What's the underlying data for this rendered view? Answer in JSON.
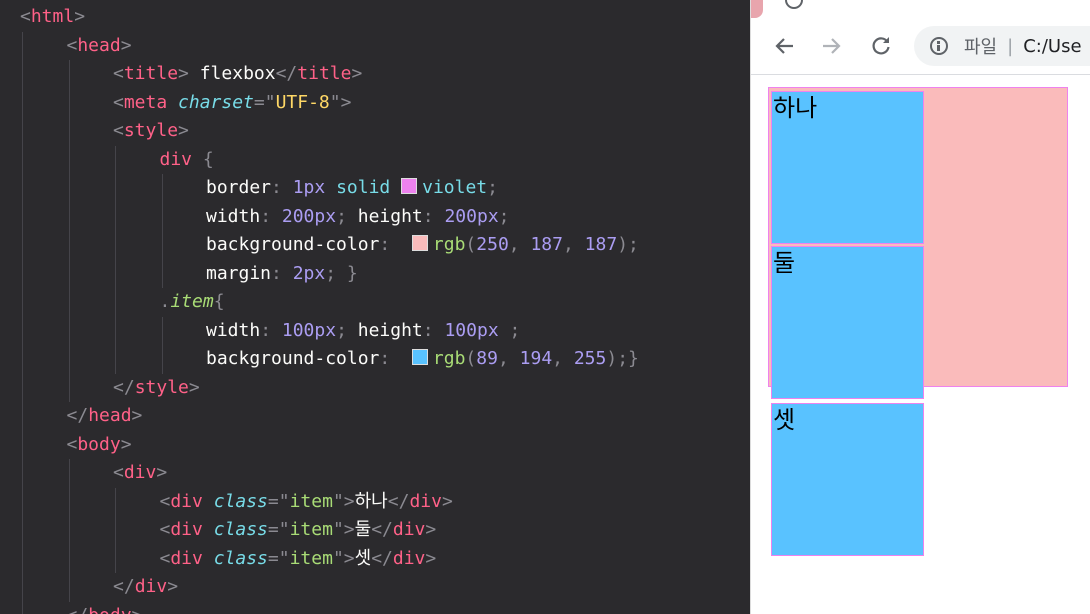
{
  "editor": {
    "lines": [
      {
        "indent": 0,
        "tokens": [
          [
            "punc",
            "<"
          ],
          [
            "tag",
            "html"
          ],
          [
            "punc",
            ">"
          ]
        ]
      },
      {
        "indent": 1,
        "tokens": [
          [
            "punc",
            "<"
          ],
          [
            "tag",
            "head"
          ],
          [
            "punc",
            ">"
          ]
        ]
      },
      {
        "indent": 2,
        "tokens": [
          [
            "punc",
            "<"
          ],
          [
            "tag",
            "title"
          ],
          [
            "punc",
            "> "
          ],
          [
            "text",
            "flexbox"
          ],
          [
            "punc",
            "</"
          ],
          [
            "tag",
            "title"
          ],
          [
            "punc",
            ">"
          ]
        ]
      },
      {
        "indent": 2,
        "tokens": [
          [
            "punc",
            "<"
          ],
          [
            "tag",
            "meta "
          ],
          [
            "attr",
            "charset"
          ],
          [
            "punc",
            "=\""
          ],
          [
            "str",
            "UTF-8"
          ],
          [
            "punc",
            "\">"
          ]
        ]
      },
      {
        "indent": 2,
        "tokens": [
          [
            "punc",
            "<"
          ],
          [
            "tag",
            "style"
          ],
          [
            "punc",
            ">"
          ]
        ]
      },
      {
        "indent": 3,
        "tokens": [
          [
            "tag",
            "div "
          ],
          [
            "punc",
            "{"
          ]
        ]
      },
      {
        "indent": 4,
        "tokens": [
          [
            "prop",
            "border"
          ],
          [
            "punc",
            ": "
          ],
          [
            "num",
            "1px "
          ],
          [
            "kw",
            "solid "
          ],
          [
            "swatch",
            "#ee82ee"
          ],
          [
            "kw",
            "violet"
          ],
          [
            "punc",
            ";"
          ]
        ]
      },
      {
        "indent": 4,
        "tokens": [
          [
            "prop",
            "width"
          ],
          [
            "punc",
            ": "
          ],
          [
            "num",
            "200px"
          ],
          [
            "punc",
            "; "
          ],
          [
            "prop",
            "height"
          ],
          [
            "punc",
            ": "
          ],
          [
            "num",
            "200px"
          ],
          [
            "punc",
            ";"
          ]
        ]
      },
      {
        "indent": 4,
        "tokens": [
          [
            "prop",
            "background-color"
          ],
          [
            "punc",
            ":  "
          ],
          [
            "swatch",
            "#fabbbb"
          ],
          [
            "fn",
            "rgb"
          ],
          [
            "punc",
            "("
          ],
          [
            "num",
            "250"
          ],
          [
            "punc",
            ", "
          ],
          [
            "num",
            "187"
          ],
          [
            "punc",
            ", "
          ],
          [
            "num",
            "187"
          ],
          [
            "punc",
            ");"
          ]
        ]
      },
      {
        "indent": 4,
        "tokens": [
          [
            "prop",
            "margin"
          ],
          [
            "punc",
            ": "
          ],
          [
            "num",
            "2px"
          ],
          [
            "punc",
            "; }"
          ]
        ]
      },
      {
        "indent": 3,
        "tokens": [
          [
            "punc",
            "."
          ],
          [
            "cls",
            "item"
          ],
          [
            "punc",
            "{"
          ]
        ]
      },
      {
        "indent": 4,
        "tokens": [
          [
            "prop",
            "width"
          ],
          [
            "punc",
            ": "
          ],
          [
            "num",
            "100px"
          ],
          [
            "punc",
            "; "
          ],
          [
            "prop",
            "height"
          ],
          [
            "punc",
            ": "
          ],
          [
            "num",
            "100px "
          ],
          [
            "punc",
            ";"
          ]
        ]
      },
      {
        "indent": 4,
        "tokens": [
          [
            "prop",
            "background-color"
          ],
          [
            "punc",
            ":  "
          ],
          [
            "swatch",
            "#59c2ff"
          ],
          [
            "fn",
            "rgb"
          ],
          [
            "punc",
            "("
          ],
          [
            "num",
            "89"
          ],
          [
            "punc",
            ", "
          ],
          [
            "num",
            "194"
          ],
          [
            "punc",
            ", "
          ],
          [
            "num",
            "255"
          ],
          [
            "punc",
            ");}"
          ]
        ]
      },
      {
        "indent": 2,
        "tokens": [
          [
            "punc",
            "</"
          ],
          [
            "tag",
            "style"
          ],
          [
            "punc",
            ">"
          ]
        ]
      },
      {
        "indent": 1,
        "tokens": [
          [
            "punc",
            "</"
          ],
          [
            "tag",
            "head"
          ],
          [
            "punc",
            ">"
          ]
        ]
      },
      {
        "indent": 1,
        "tokens": [
          [
            "punc",
            "<"
          ],
          [
            "tag",
            "body"
          ],
          [
            "punc",
            ">"
          ]
        ]
      },
      {
        "indent": 2,
        "tokens": [
          [
            "punc",
            "<"
          ],
          [
            "tag",
            "div"
          ],
          [
            "punc",
            ">"
          ]
        ]
      },
      {
        "indent": 3,
        "tokens": [
          [
            "punc",
            "<"
          ],
          [
            "tag",
            "div "
          ],
          [
            "attr",
            "class"
          ],
          [
            "punc",
            "=\""
          ],
          [
            "strg",
            "item"
          ],
          [
            "punc",
            "\">"
          ],
          [
            "text",
            "하나"
          ],
          [
            "punc",
            "</"
          ],
          [
            "tag",
            "div"
          ],
          [
            "punc",
            ">"
          ]
        ]
      },
      {
        "indent": 3,
        "tokens": [
          [
            "punc",
            "<"
          ],
          [
            "tag",
            "div "
          ],
          [
            "attr",
            "class"
          ],
          [
            "punc",
            "=\""
          ],
          [
            "strg",
            "item"
          ],
          [
            "punc",
            "\">"
          ],
          [
            "text",
            "둘"
          ],
          [
            "punc",
            "</"
          ],
          [
            "tag",
            "div"
          ],
          [
            "punc",
            ">"
          ]
        ]
      },
      {
        "indent": 3,
        "tokens": [
          [
            "punc",
            "<"
          ],
          [
            "tag",
            "div "
          ],
          [
            "attr",
            "class"
          ],
          [
            "punc",
            "=\""
          ],
          [
            "strg",
            "item"
          ],
          [
            "punc",
            "\">"
          ],
          [
            "text",
            "셋"
          ],
          [
            "punc",
            "</"
          ],
          [
            "tag",
            "div"
          ],
          [
            "punc",
            ">"
          ]
        ]
      },
      {
        "indent": 2,
        "tokens": [
          [
            "punc",
            "</"
          ],
          [
            "tag",
            "div"
          ],
          [
            "punc",
            ">"
          ]
        ]
      },
      {
        "indent": 1,
        "tokens": [
          [
            "punc",
            "</"
          ],
          [
            "tag",
            "body"
          ],
          [
            "punc",
            ">"
          ]
        ]
      }
    ]
  },
  "browser": {
    "back_icon": "arrow-left-icon",
    "forward_icon": "arrow-right-icon",
    "reload_icon": "reload-icon",
    "address": {
      "info_icon": "info-icon",
      "label": "파일",
      "separator": "|",
      "url": "C:/Use"
    },
    "rendered": {
      "container_color": "#fabbbb",
      "item_color": "#59c2ff",
      "border_color": "#ee82ee",
      "items": [
        "하나",
        "둘",
        "셋"
      ]
    }
  }
}
